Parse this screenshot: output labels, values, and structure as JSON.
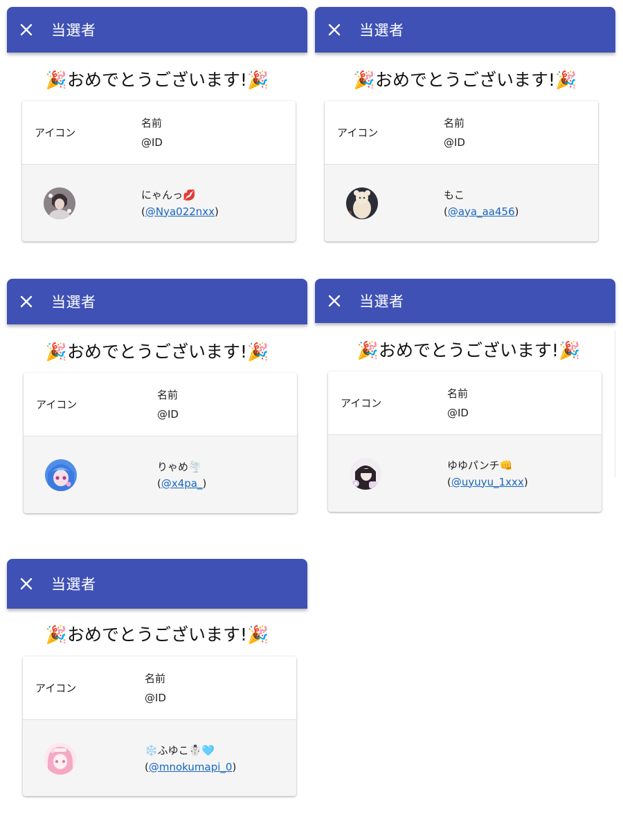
{
  "panels": [
    {
      "title": "当選者",
      "congrats": "🎉おめでとうございます!🎉",
      "table": {
        "col_icon": "アイコン",
        "col_name": "名前",
        "col_id": "@ID"
      },
      "winner": {
        "name": "にゃんっ💋",
        "id": "@Nya022nxx",
        "open_paren": "(",
        "close_paren": ")",
        "avatar": "avatar-girl-gray"
      }
    },
    {
      "title": "当選者",
      "congrats": "🎉おめでとうございます!🎉",
      "table": {
        "col_icon": "アイコン",
        "col_name": "名前",
        "col_id": "@ID"
      },
      "winner": {
        "name": "もこ",
        "id": "@aya_aa456",
        "open_paren": "(",
        "close_paren": ")",
        "avatar": "avatar-plush-bear"
      }
    },
    {
      "title": "当選者",
      "congrats": "🎉おめでとうございます!🎉",
      "table": {
        "col_icon": "アイコン",
        "col_name": "名前",
        "col_id": "@ID"
      },
      "winner": {
        "name": "りゃめ🌪️",
        "id": "@x4pa_",
        "open_paren": "(",
        "close_paren": ")",
        "avatar": "avatar-anime-blue"
      }
    },
    {
      "title": "当選者",
      "congrats": "🎉おめでとうございます!🎉",
      "table": {
        "col_icon": "アイコン",
        "col_name": "名前",
        "col_id": "@ID"
      },
      "winner": {
        "name": "ゆゆパンチ👊",
        "id": "@uyuyu_1xxx",
        "open_paren": "(",
        "close_paren": ")",
        "avatar": "avatar-girl-pastel"
      }
    },
    {
      "title": "当選者",
      "congrats": "🎉おめでとうございます!🎉",
      "table": {
        "col_icon": "アイコン",
        "col_name": "名前",
        "col_id": "@ID"
      },
      "winner": {
        "name": "❄️ふゆこ☃️🩵",
        "id": "@mnokumapi_0",
        "open_paren": "(",
        "close_paren": ")",
        "avatar": "avatar-anime-pink"
      }
    }
  ],
  "colors": {
    "appbar": "#3f51b5",
    "link": "#1565c0",
    "row_bg": "#f5f5f5"
  }
}
